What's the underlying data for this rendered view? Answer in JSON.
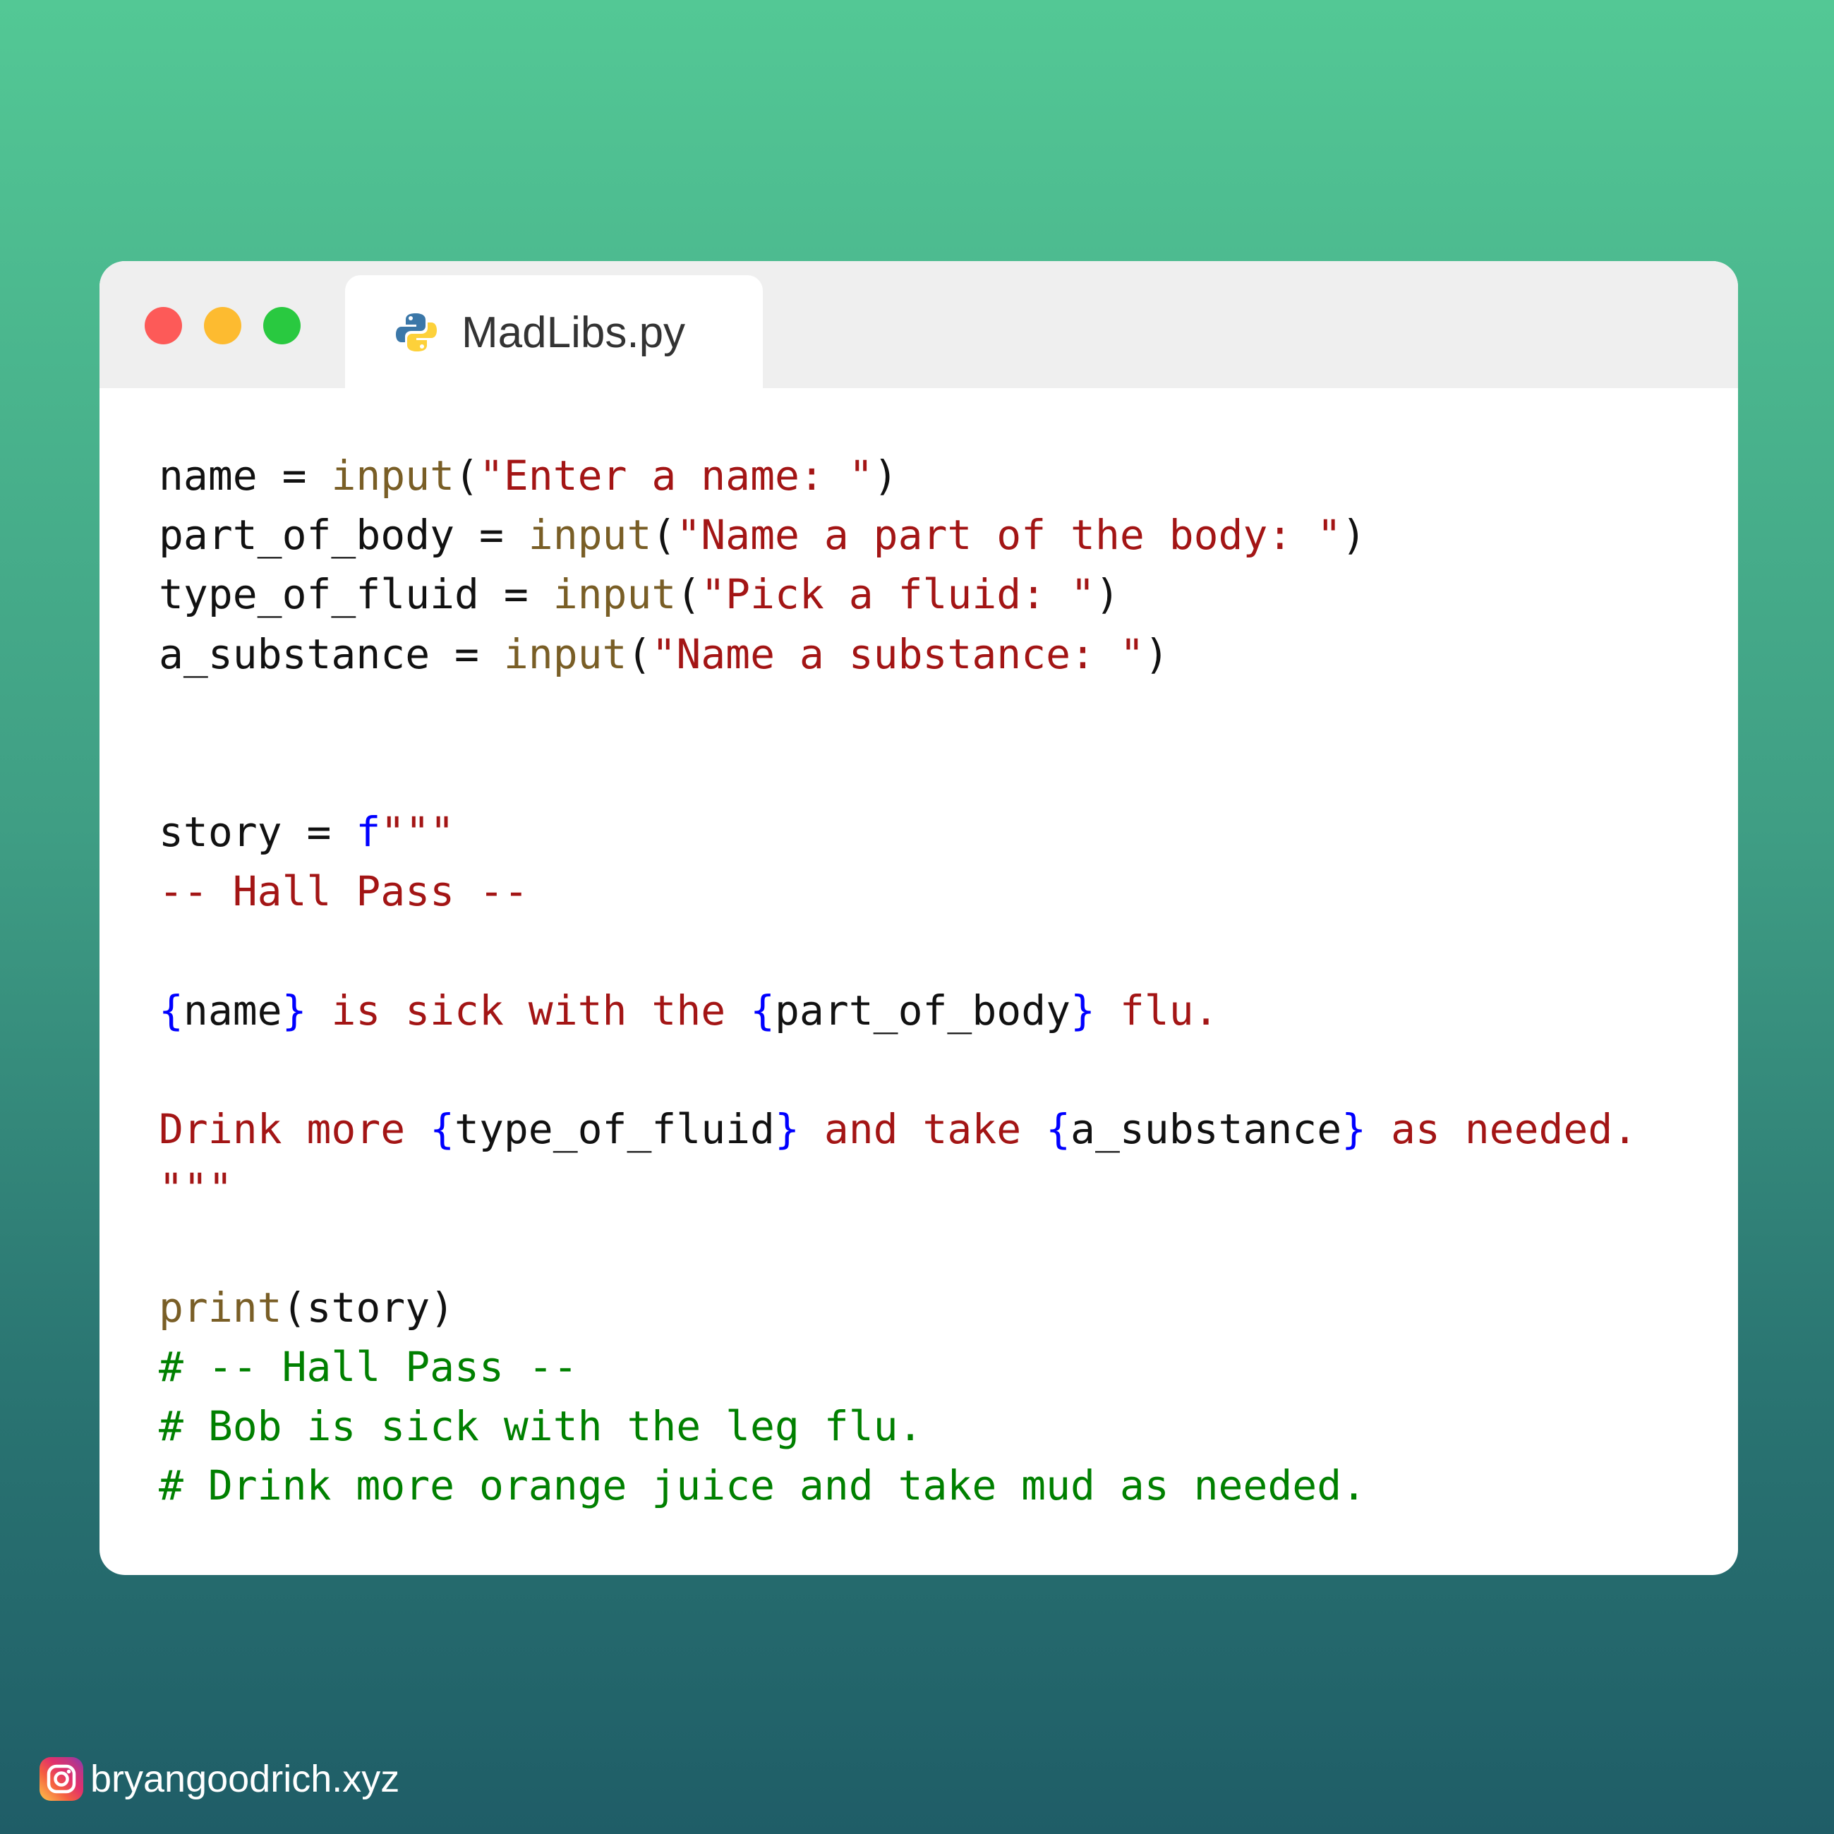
{
  "editor": {
    "tab": {
      "filename": "MadLibs.py",
      "icon": "python-icon"
    },
    "window_controls": [
      "close-button",
      "minimize-button",
      "maximize-button"
    ],
    "code_lines": [
      [
        {
          "t": "name = ",
          "c": "plain"
        },
        {
          "t": "input",
          "c": "func"
        },
        {
          "t": "(",
          "c": "plain"
        },
        {
          "t": "\"Enter a name: \"",
          "c": "str"
        },
        {
          "t": ")",
          "c": "plain"
        }
      ],
      [
        {
          "t": "part_of_body = ",
          "c": "plain"
        },
        {
          "t": "input",
          "c": "func"
        },
        {
          "t": "(",
          "c": "plain"
        },
        {
          "t": "\"Name a part of the body: \"",
          "c": "str"
        },
        {
          "t": ")",
          "c": "plain"
        }
      ],
      [
        {
          "t": "type_of_fluid = ",
          "c": "plain"
        },
        {
          "t": "input",
          "c": "func"
        },
        {
          "t": "(",
          "c": "plain"
        },
        {
          "t": "\"Pick a fluid: \"",
          "c": "str"
        },
        {
          "t": ")",
          "c": "plain"
        }
      ],
      [
        {
          "t": "a_substance = ",
          "c": "plain"
        },
        {
          "t": "input",
          "c": "func"
        },
        {
          "t": "(",
          "c": "plain"
        },
        {
          "t": "\"Name a substance: \"",
          "c": "str"
        },
        {
          "t": ")",
          "c": "plain"
        }
      ],
      [],
      [],
      [
        {
          "t": "story = ",
          "c": "plain"
        },
        {
          "t": "f",
          "c": "kw"
        },
        {
          "t": "\"\"\"",
          "c": "str"
        }
      ],
      [
        {
          "t": "-- Hall Pass --",
          "c": "str"
        }
      ],
      [],
      [
        {
          "t": "{",
          "c": "brace"
        },
        {
          "t": "name",
          "c": "plain"
        },
        {
          "t": "}",
          "c": "brace"
        },
        {
          "t": " is sick with the ",
          "c": "str"
        },
        {
          "t": "{",
          "c": "brace"
        },
        {
          "t": "part_of_body",
          "c": "plain"
        },
        {
          "t": "}",
          "c": "brace"
        },
        {
          "t": " flu.",
          "c": "str"
        }
      ],
      [],
      [
        {
          "t": "Drink more ",
          "c": "str"
        },
        {
          "t": "{",
          "c": "brace"
        },
        {
          "t": "type_of_fluid",
          "c": "plain"
        },
        {
          "t": "}",
          "c": "brace"
        },
        {
          "t": " and take ",
          "c": "str"
        },
        {
          "t": "{",
          "c": "brace"
        },
        {
          "t": "a_substance",
          "c": "plain"
        },
        {
          "t": "}",
          "c": "brace"
        },
        {
          "t": " as needed.",
          "c": "str"
        }
      ],
      [
        {
          "t": "\"\"\"",
          "c": "str"
        }
      ],
      [],
      [
        {
          "t": "print",
          "c": "func"
        },
        {
          "t": "(story)",
          "c": "plain"
        }
      ],
      [
        {
          "t": "# -- Hall Pass --",
          "c": "comment"
        }
      ],
      [
        {
          "t": "# Bob is sick with the leg flu.",
          "c": "comment"
        }
      ],
      [
        {
          "t": "# Drink more orange juice and take mud as needed.",
          "c": "comment"
        }
      ]
    ]
  },
  "footer": {
    "icon": "instagram-icon",
    "handle": "bryangoodrich.xyz"
  },
  "colors": {
    "background_top": "#53c895",
    "background_bottom": "#1f5d67",
    "titlebar": "#efefef",
    "close": "#fd5a58",
    "minimize": "#fdbb30",
    "maximize": "#29c940",
    "code_plain": "#111111",
    "code_function": "#795e26",
    "code_string": "#a31515",
    "code_keyword": "#0000ff",
    "code_comment": "#008000"
  }
}
